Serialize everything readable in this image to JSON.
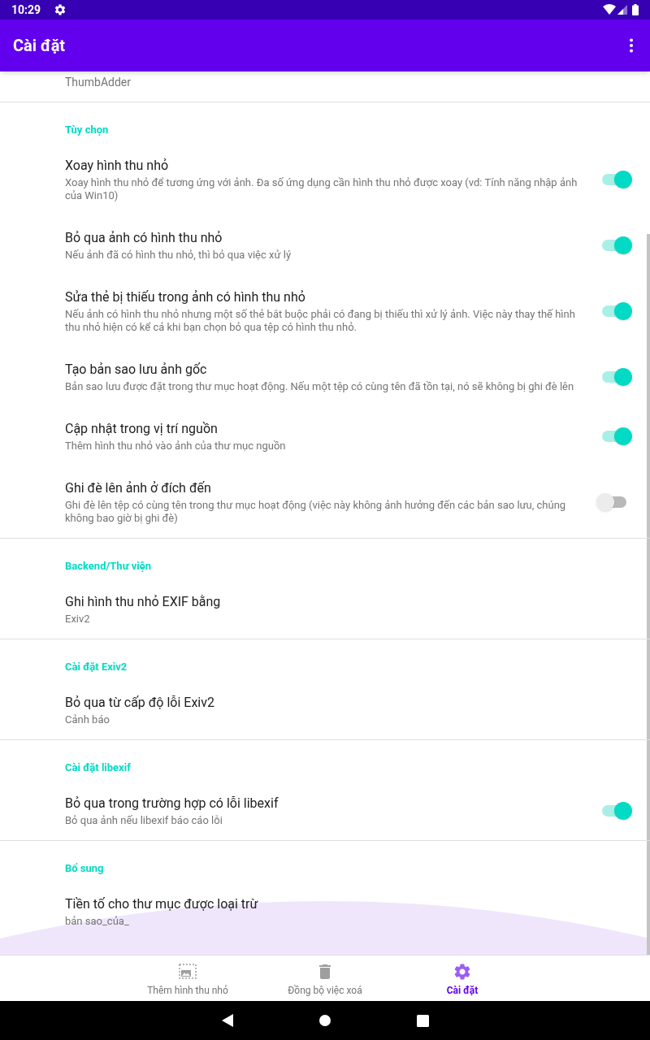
{
  "status_bar": {
    "time": "10:29"
  },
  "app_bar": {
    "title": "Cài đặt"
  },
  "top_item": {
    "summary": "ThumbAdder"
  },
  "sections": [
    {
      "header": "Tùy chọn",
      "items": [
        {
          "kind": "switch",
          "title": "Xoay hình thu nhỏ",
          "summary": "Xoay hình thu nhỏ để tương ứng với ảnh. Đa số ứng dụng cần hình thu nhỏ được xoay (vd: Tính năng nhập ảnh của Win10)",
          "on": true
        },
        {
          "kind": "switch",
          "title": "Bỏ qua ảnh có hình thu nhỏ",
          "summary": "Nếu ảnh đã có hình thu nhỏ, thì bỏ qua việc xử lý",
          "on": true
        },
        {
          "kind": "switch",
          "title": "Sửa thẻ bị thiếu trong ảnh có hình thu nhỏ",
          "summary": "Nếu ảnh có hình thu nhỏ nhưng một số thẻ bắt buộc phải có đang bị thiếu thì xử lý ảnh. Việc này thay thế hình thu nhỏ hiện có kể cả khi bạn chọn bỏ qua tệp có hình thu nhỏ.",
          "on": true
        },
        {
          "kind": "switch",
          "title": "Tạo bản sao lưu ảnh gốc",
          "summary": "Bản sao lưu được đặt trong thư mục hoạt động. Nếu một tệp có cùng tên đã tồn tại, nó sẽ không bị ghi đè lên",
          "on": true
        },
        {
          "kind": "switch",
          "title": "Cập nhật trong vị trí nguồn",
          "summary": "Thêm hình thu nhỏ vào ảnh của thư mục nguồn",
          "on": true
        },
        {
          "kind": "switch",
          "title": "Ghi đè lên ảnh ở đích đến",
          "summary": "Ghi đè lên tệp có cùng tên trong thư mục hoạt động (việc này không ảnh hưởng đến các bản sao lưu, chúng không bao giờ bị ghi đè)",
          "on": false
        }
      ]
    },
    {
      "header": "Backend/Thư viện",
      "items": [
        {
          "kind": "list",
          "title": "Ghi hình thu nhỏ EXIF bằng",
          "summary": "Exiv2"
        }
      ]
    },
    {
      "header": "Cài đặt Exiv2",
      "items": [
        {
          "kind": "list",
          "title": "Bỏ qua từ cấp độ lỗi Exiv2",
          "summary": "Cảnh báo"
        }
      ]
    },
    {
      "header": "Cài đặt libexif",
      "items": [
        {
          "kind": "switch",
          "title": "Bỏ qua trong trường hợp có lỗi libexif",
          "summary": "Bỏ qua ảnh nếu libexif báo cáo lỗi",
          "on": true
        }
      ]
    },
    {
      "header": "Bổ sung",
      "items": [
        {
          "kind": "text",
          "title": "Tiền tố cho thư mục được loại trừ",
          "summary": "bản sao_của_"
        }
      ]
    }
  ],
  "bottom_nav": [
    {
      "kind": "thumbnail",
      "label": "Thêm hình thu nhỏ",
      "selected": false
    },
    {
      "kind": "trash",
      "label": "Đồng bộ việc xoá",
      "selected": false
    },
    {
      "kind": "gear",
      "label": "Cài đặt",
      "selected": true
    }
  ]
}
